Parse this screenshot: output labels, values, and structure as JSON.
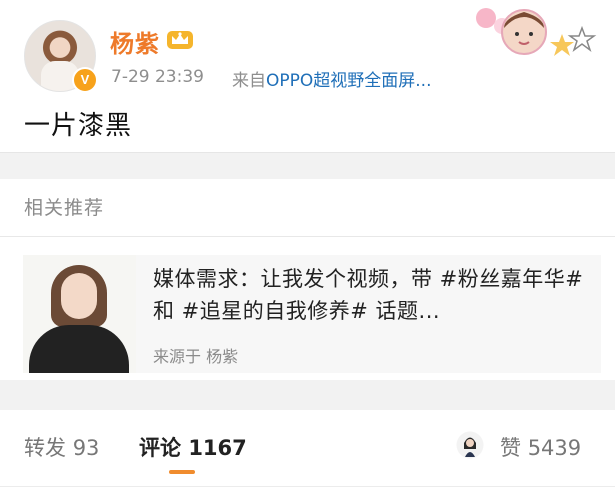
{
  "post": {
    "username": "杨紫",
    "time": "7-29 23:39",
    "source_prefix": "来自",
    "source_link": "OPPO超视野全面屏...",
    "verified_mark": "V",
    "text": "一片漆黑"
  },
  "recommend": {
    "section_title": "相关推荐",
    "card": {
      "title": "媒体需求：让我发个视频，带 #粉丝嘉年华# 和 #追星的自我修养# 话题...",
      "source": "来源于 杨紫"
    }
  },
  "actions": {
    "repost_label": "转发",
    "repost_count": "93",
    "comment_label": "评论",
    "comment_count": "1167",
    "like_label": "赞",
    "like_count": "5439"
  },
  "icons": {
    "crown": "crown-icon",
    "verified": "verified-badge-icon",
    "sticker": "decorative-sticker",
    "like_avatar": "like-user-avatar"
  },
  "colors": {
    "accent_orange": "#ee7a2a",
    "link_blue": "#1f6fb8",
    "tab_underline": "#f08c2e"
  }
}
